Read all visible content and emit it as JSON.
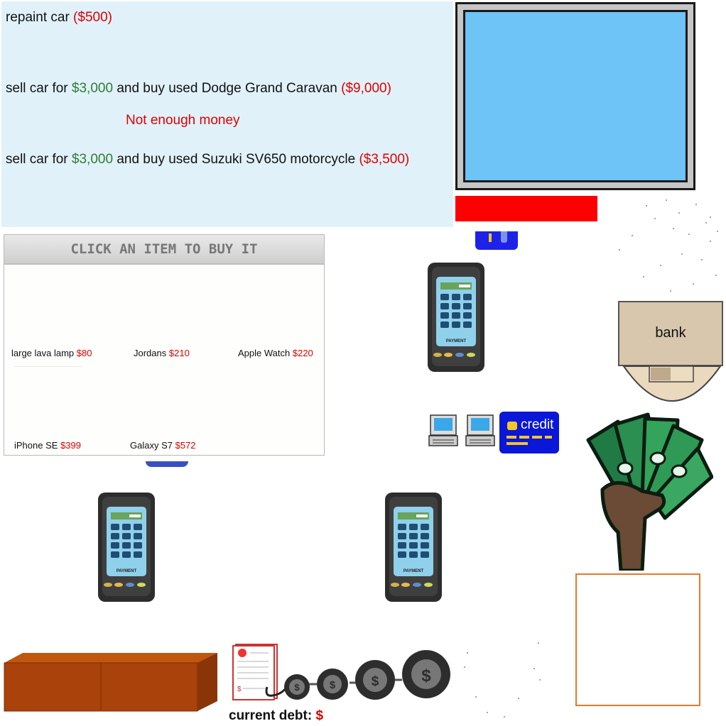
{
  "options": {
    "repaint": {
      "text": "repaint car ",
      "price": "($500)"
    },
    "caravan": {
      "pre": "sell car for ",
      "sell_price": "$3,000",
      "mid": " and buy used Dodge Grand Caravan ",
      "price": "($9,000)"
    },
    "warning": "Not enough money",
    "motorcycle": {
      "pre": "sell car for ",
      "sell_price": "$3,000",
      "mid": " and buy used Suzuki SV650 motorcycle ",
      "price": "($3,500)"
    }
  },
  "shop": {
    "title": "CLICK AN ITEM TO BUY IT",
    "items": [
      {
        "name": "large lava lamp",
        "price": "$80"
      },
      {
        "name": "Jordans",
        "price": "$210"
      },
      {
        "name": "Apple Watch",
        "price": "$220"
      },
      {
        "name": "iPhone SE",
        "price": "$399"
      },
      {
        "name": "Galaxy S7",
        "price": "$572"
      }
    ]
  },
  "terminal": {
    "label": "PAYMENT"
  },
  "bank": {
    "label": "bank"
  },
  "credit": {
    "label": "credit"
  },
  "debt": {
    "label": "current debt",
    "sep": ":",
    "value": "$"
  },
  "colors": {
    "panel_bg": "#e1f1fa",
    "price_red": "#e00000",
    "money_green": "#2e7d32",
    "credit_blue": "#0a16d8"
  }
}
